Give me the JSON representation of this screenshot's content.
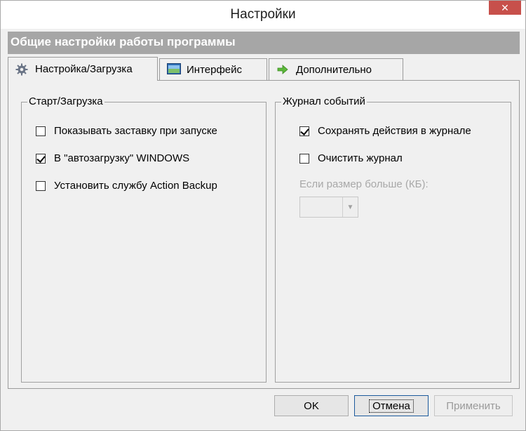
{
  "window": {
    "title": "Настройки",
    "close_glyph": "✕"
  },
  "header": {
    "title": "Общие настройки работы программы"
  },
  "tabs": [
    {
      "label": "Настройка/Загрузка",
      "icon": "gear-icon",
      "active": true
    },
    {
      "label": "Интерфейс",
      "icon": "window-icon",
      "active": false
    },
    {
      "label": "Дополнительно",
      "icon": "arrow-right-icon",
      "active": false
    }
  ],
  "startup_group": {
    "title": "Старт/Загрузка",
    "items": [
      {
        "label": "Показывать заставку при запуске",
        "checked": false
      },
      {
        "label": "В \"автозагрузку\" WINDOWS",
        "checked": true
      },
      {
        "label": "Установить службу Action Backup",
        "checked": false
      }
    ]
  },
  "log_group": {
    "title": "Журнал событий",
    "items": [
      {
        "label": "Сохранять действия в журнале",
        "checked": true
      },
      {
        "label": "Очистить журнал",
        "checked": false
      }
    ],
    "size_label": "Если размер больше (КБ):",
    "size_value": ""
  },
  "buttons": {
    "ok": "OK",
    "cancel": "Отмена",
    "apply": "Применить"
  },
  "colors": {
    "header_bg": "#a6a6a6",
    "close_bg": "#c7504b",
    "window_bg": "#f0f0f0"
  }
}
